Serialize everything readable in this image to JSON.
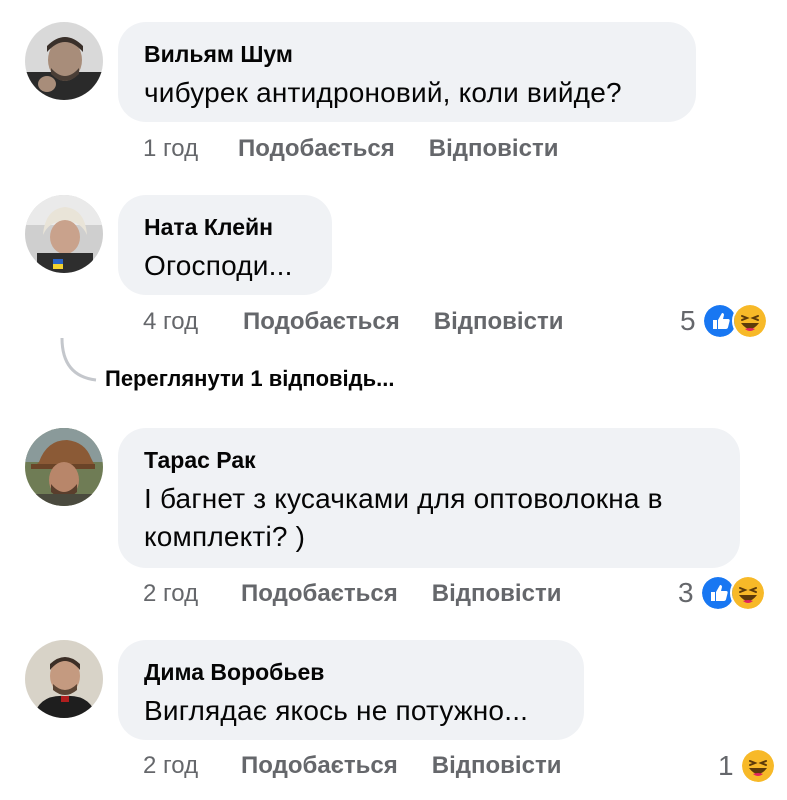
{
  "comments": [
    {
      "author": "Вильям Шум",
      "text": "чибурек антидроновий, коли вийде?",
      "time": "1 год",
      "like_label": "Подобається",
      "reply_label": "Відповісти",
      "avatar": "man-avatar-icon"
    },
    {
      "author": "Ната Клейн",
      "text": "Огосподи...",
      "time": "4 год",
      "like_label": "Подобається",
      "reply_label": "Відповісти",
      "reaction_count": "5",
      "reactions": [
        "like-icon",
        "laugh-icon"
      ],
      "avatar": "woman-avatar-icon"
    },
    {
      "author": "Тарас Рак",
      "text_line1": "І багнет з кусачками для оптоволокна в",
      "text_line2": "комплекті? )",
      "time": "2 год",
      "like_label": "Подобається",
      "reply_label": "Відповісти",
      "reaction_count": "3",
      "reactions": [
        "like-icon",
        "laugh-icon"
      ],
      "avatar": "man-hat-avatar-icon"
    },
    {
      "author": "Дима Воробьев",
      "text": "Виглядає якось не потужно...",
      "time": "2 год",
      "like_label": "Подобається",
      "reply_label": "Відповісти",
      "reaction_count": "1",
      "reactions": [
        "laugh-icon"
      ],
      "avatar": "man-avatar-icon"
    }
  ],
  "view_replies": "Переглянути 1 відповідь...",
  "colors": {
    "bubble": "#f0f2f5",
    "meta_text": "#65676b",
    "like_blue": "#1877f2",
    "laugh_yellow": "#f7b928"
  }
}
